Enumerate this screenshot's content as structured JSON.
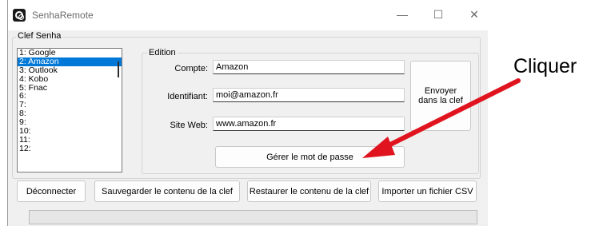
{
  "window": {
    "title": "SenhaRemote",
    "controls": {
      "minimize": "—",
      "maximize": "☐",
      "close": "✕"
    }
  },
  "clef_group": {
    "label": "Clef Senha",
    "entries": [
      "1: Google",
      "2: Amazon",
      "3: Outlook",
      "4: Kobo",
      "5: Fnac",
      "6:",
      "7:",
      "8:",
      "9:",
      "10:",
      "11:",
      "12:"
    ],
    "selected_index": 1
  },
  "edition": {
    "label": "Edition",
    "compte_label": "Compte:",
    "compte_value": "Amazon",
    "identifiant_label": "Identifiant:",
    "identifiant_value": "moi@amazon.fr",
    "site_label": "Site Web:",
    "site_value": "www.amazon.fr",
    "send_button": {
      "line1": "Envoyer",
      "line2": "dans la clef"
    },
    "manage_password_button": "Gérer le mot de passe"
  },
  "bottom_buttons": {
    "disconnect": "Déconnecter",
    "save": "Sauvegarder le contenu de la clef",
    "restore": "Restaurer le contenu de la clef",
    "import_csv": "Importer un fichier CSV"
  },
  "annotation": {
    "text": "Cliquer",
    "arrow_color": "#e0141e"
  },
  "colors": {
    "selection": "#0078d7",
    "window_bg": "#f0f0f0"
  }
}
